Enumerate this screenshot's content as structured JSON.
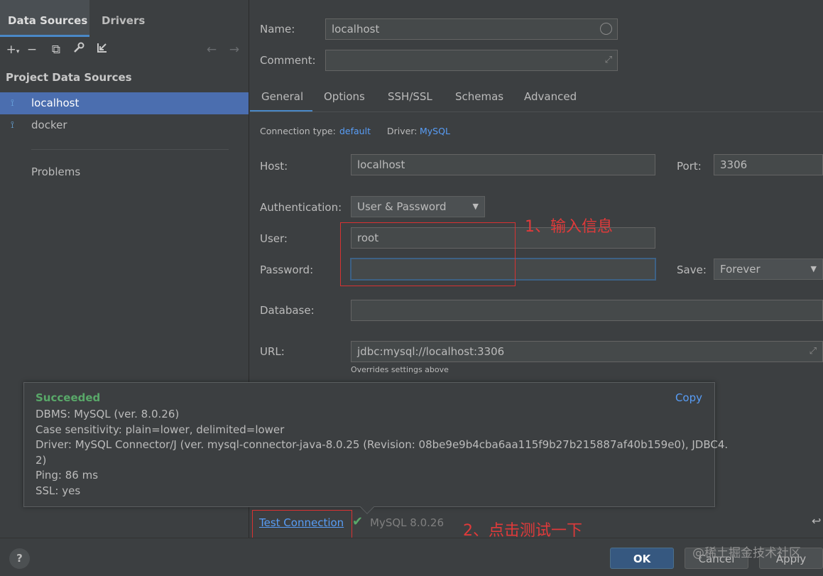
{
  "sidebar": {
    "tabs": [
      "Data Sources",
      "Drivers"
    ],
    "section_title": "Project Data Sources",
    "items": [
      {
        "label": "localhost",
        "selected": true
      },
      {
        "label": "docker",
        "selected": false
      }
    ],
    "problems_label": "Problems"
  },
  "form": {
    "name_label": "Name:",
    "name_value": "localhost",
    "comment_label": "Comment:",
    "comment_value": "",
    "tabs": [
      "General",
      "Options",
      "SSH/SSL",
      "Schemas",
      "Advanced"
    ],
    "connection_type_label": "Connection type:",
    "connection_type_value": "default",
    "driver_label": "Driver:",
    "driver_value": "MySQL",
    "host_label": "Host:",
    "host_value": "localhost",
    "port_label": "Port:",
    "port_value": "3306",
    "auth_label": "Authentication:",
    "auth_value": "User & Password",
    "user_label": "User:",
    "user_value": "root",
    "password_label": "Password:",
    "password_value": "",
    "save_label": "Save:",
    "save_value": "Forever",
    "database_label": "Database:",
    "database_value": "",
    "url_label": "URL:",
    "url_value": "jdbc:mysql://localhost:3306",
    "url_hint": "Overrides settings above"
  },
  "annotations": {
    "note1": "1、输入信息",
    "note2": "2、点击测试一下"
  },
  "popup": {
    "title": "Succeeded",
    "copy_label": "Copy",
    "lines": [
      "DBMS: MySQL (ver. 8.0.26)",
      "Case sensitivity: plain=lower, delimited=lower",
      "Driver: MySQL Connector/J (ver. mysql-connector-java-8.0.25 (Revision: 08be9e9b4cba6aa115f9b27b215887af40b159e0), JDBC4.",
      "2)",
      "Ping: 86 ms",
      "SSL: yes"
    ]
  },
  "test": {
    "button_label": "Test Connection",
    "status_text": "MySQL 8.0.26"
  },
  "buttons": {
    "help": "?",
    "ok": "OK",
    "cancel": "Cancel",
    "apply": "Apply"
  },
  "watermark": "@稀土掘金技术社区",
  "colors": {
    "background": "#3c3f41",
    "selection": "#4b6eaf",
    "accent": "#4a88c7",
    "link": "#589df6",
    "success": "#59a869",
    "annotation": "#e03a3a"
  }
}
